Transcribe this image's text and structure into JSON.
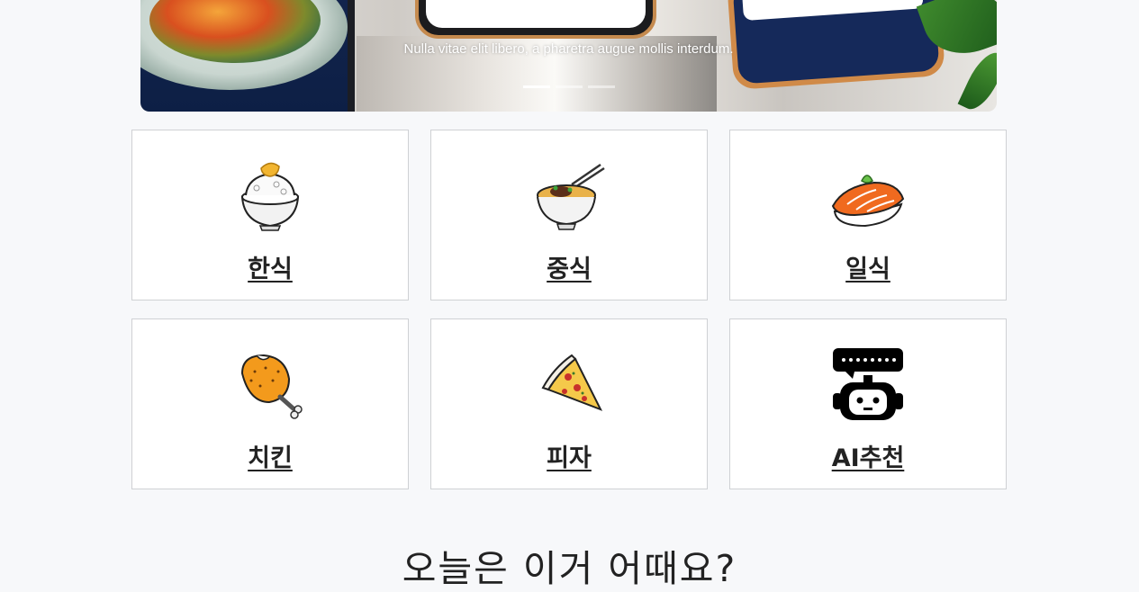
{
  "carousel": {
    "caption": "Nulla vitae elit libero, a pharetra augue mollis interdum.",
    "slides_total": 3,
    "active_slide": 1
  },
  "categories": [
    {
      "label": "한식",
      "icon": "rice-bowl-icon"
    },
    {
      "label": "중식",
      "icon": "noodle-bowl-icon"
    },
    {
      "label": "일식",
      "icon": "sushi-icon"
    },
    {
      "label": "치킨",
      "icon": "chicken-drumstick-icon"
    },
    {
      "label": "피자",
      "icon": "pizza-slice-icon"
    },
    {
      "label": "AI추천",
      "icon": "robot-chat-icon"
    }
  ],
  "recommend": {
    "heading": "오늘은 이거 어때요?"
  }
}
